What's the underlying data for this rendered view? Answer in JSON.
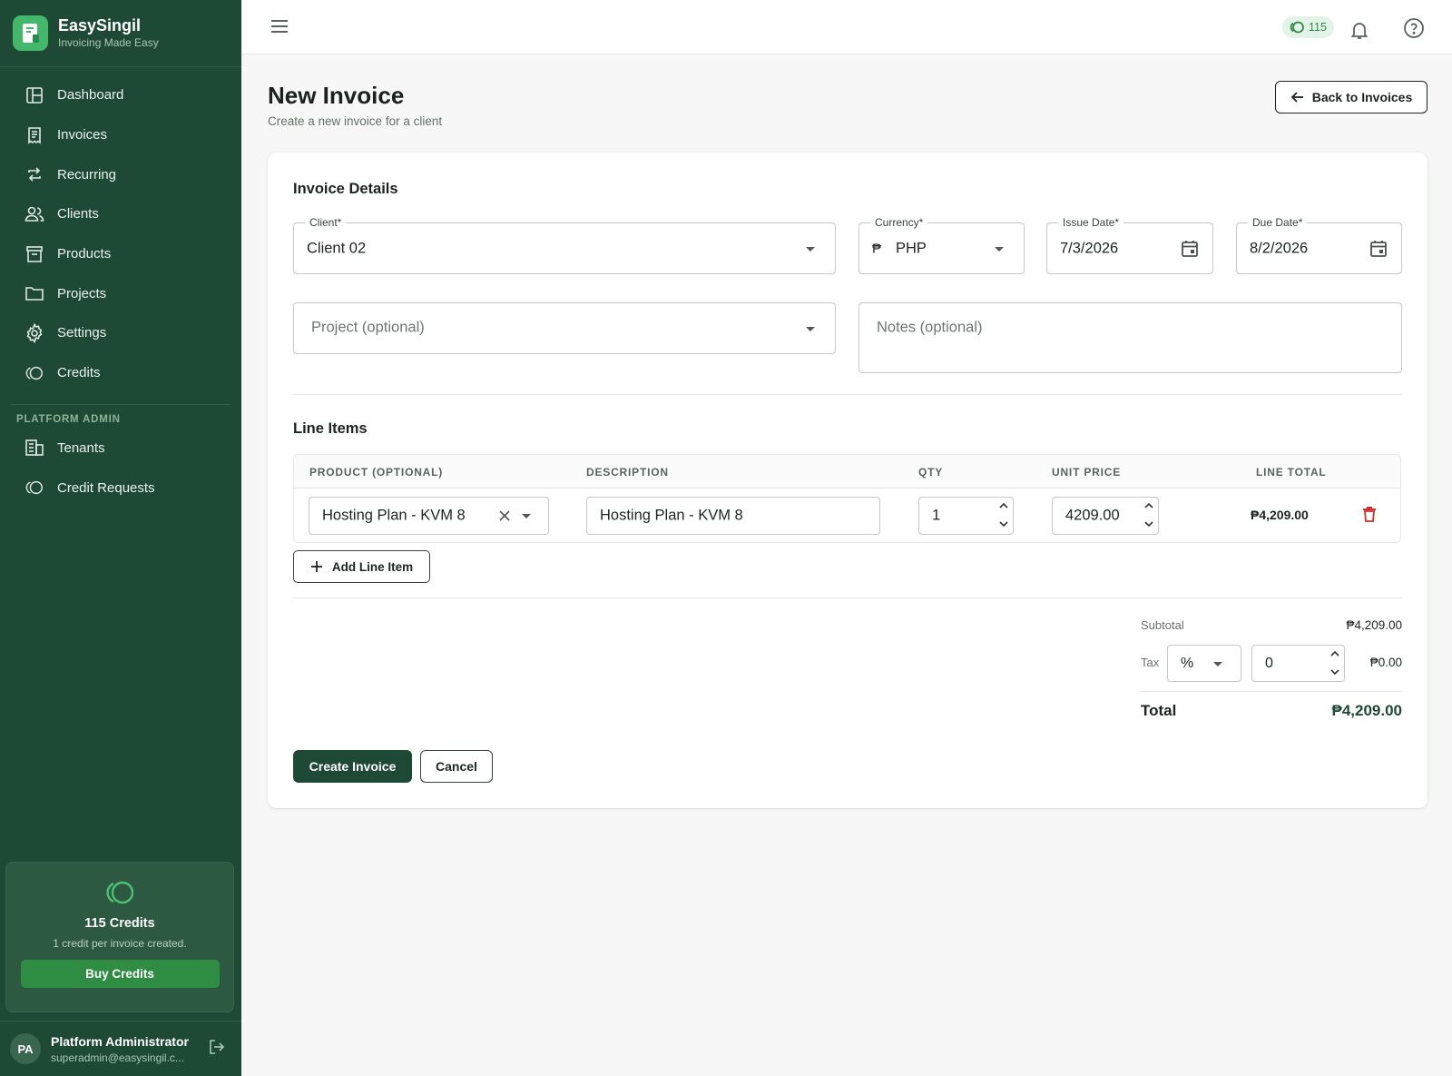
{
  "app": {
    "name": "EasySingil",
    "tagline": "Invoicing Made Easy"
  },
  "sidebar": {
    "items": [
      {
        "label": "Dashboard",
        "icon": "dashboard-icon"
      },
      {
        "label": "Invoices",
        "icon": "invoice-icon"
      },
      {
        "label": "Recurring",
        "icon": "repeat-icon"
      },
      {
        "label": "Clients",
        "icon": "people-icon"
      },
      {
        "label": "Products",
        "icon": "archive-icon"
      },
      {
        "label": "Projects",
        "icon": "folder-icon"
      },
      {
        "label": "Settings",
        "icon": "gear-icon"
      },
      {
        "label": "Credits",
        "icon": "credits-icon"
      }
    ],
    "admin_section": "PLATFORM ADMIN",
    "admin_items": [
      {
        "label": "Tenants",
        "icon": "building-icon"
      },
      {
        "label": "Credit Requests",
        "icon": "credits-icon"
      }
    ],
    "credits_card": {
      "title": "115 Credits",
      "subtitle": "1 credit per invoice created.",
      "button": "Buy Credits"
    },
    "user": {
      "initials": "PA",
      "name": "Platform Administrator",
      "email": "superadmin@easysingil.c..."
    }
  },
  "topbar": {
    "credits_count": "115"
  },
  "page": {
    "title": "New Invoice",
    "subtitle": "Create a new invoice for a client",
    "back_button": "Back to Invoices"
  },
  "invoice_details": {
    "section_title": "Invoice Details",
    "client": {
      "label": "Client*",
      "value": "Client 02"
    },
    "currency": {
      "label": "Currency*",
      "symbol": "₱",
      "value": "PHP"
    },
    "issue_date": {
      "label": "Issue Date*",
      "value": "7/3/2026"
    },
    "due_date": {
      "label": "Due Date*",
      "value": "8/2/2026"
    },
    "project": {
      "placeholder": "Project (optional)"
    },
    "notes": {
      "placeholder": "Notes (optional)"
    }
  },
  "line_items": {
    "section_title": "Line Items",
    "headers": [
      "PRODUCT (OPTIONAL)",
      "DESCRIPTION",
      "QTY",
      "UNIT PRICE",
      "LINE TOTAL"
    ],
    "rows": [
      {
        "product": "Hosting Plan - KVM 8",
        "description": "Hosting Plan - KVM 8",
        "qty": "1",
        "unit_price": "4209.00",
        "line_total": "₱4,209.00"
      }
    ],
    "add_button": "Add Line Item"
  },
  "summary": {
    "subtotal_label": "Subtotal",
    "subtotal_value": "₱4,209.00",
    "tax_label": "Tax",
    "tax_type": "%",
    "tax_rate": "0",
    "tax_value": "₱0.00",
    "total_label": "Total",
    "total_value": "₱4,209.00"
  },
  "actions": {
    "create": "Create Invoice",
    "cancel": "Cancel"
  },
  "colors": {
    "sidebar": "#1e4a35",
    "accent": "#2e8c43",
    "danger": "#d32f2f"
  }
}
